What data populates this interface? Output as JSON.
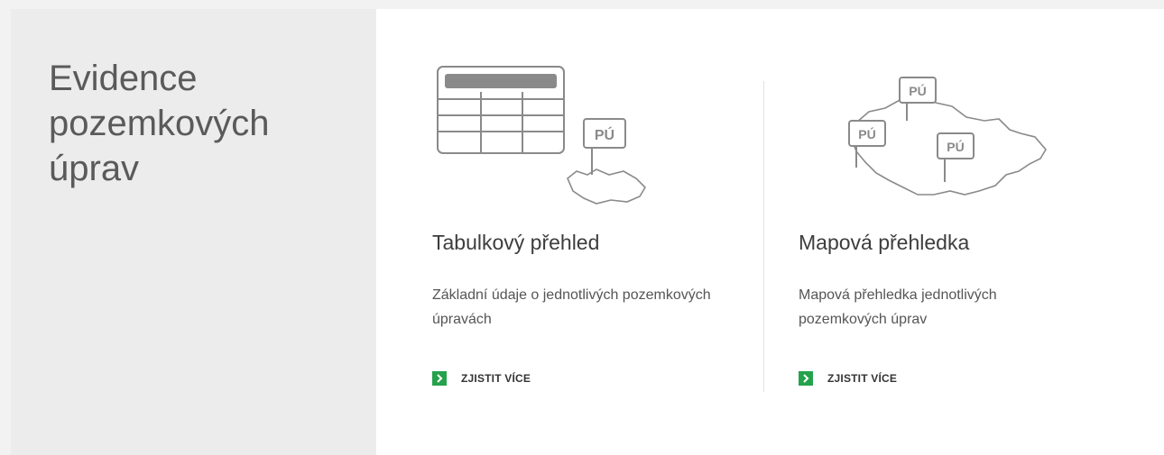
{
  "sidebar": {
    "title": "Evidence pozemkových úprav"
  },
  "cards": [
    {
      "title": "Tabulkový přehled",
      "description": "Základní údaje o jednotlivých pozemkových úpravách",
      "cta_label": "ZJISTIT VÍCE",
      "illustration": "table-with-pu-flag-icon",
      "badge": "PÚ"
    },
    {
      "title": "Mapová přehledka",
      "description": "Mapová přehledka jednotlivých pozemkových úprav",
      "cta_label": "ZJISTIT VÍCE",
      "illustration": "czech-map-with-pu-flags-icon",
      "badges": [
        "PÚ",
        "PÚ",
        "PÚ"
      ]
    }
  ],
  "colors": {
    "accent": "#25a24b",
    "left_bg": "#ececec",
    "page_bg": "#f2f2f2",
    "icon_stroke": "#8a8a8a"
  }
}
